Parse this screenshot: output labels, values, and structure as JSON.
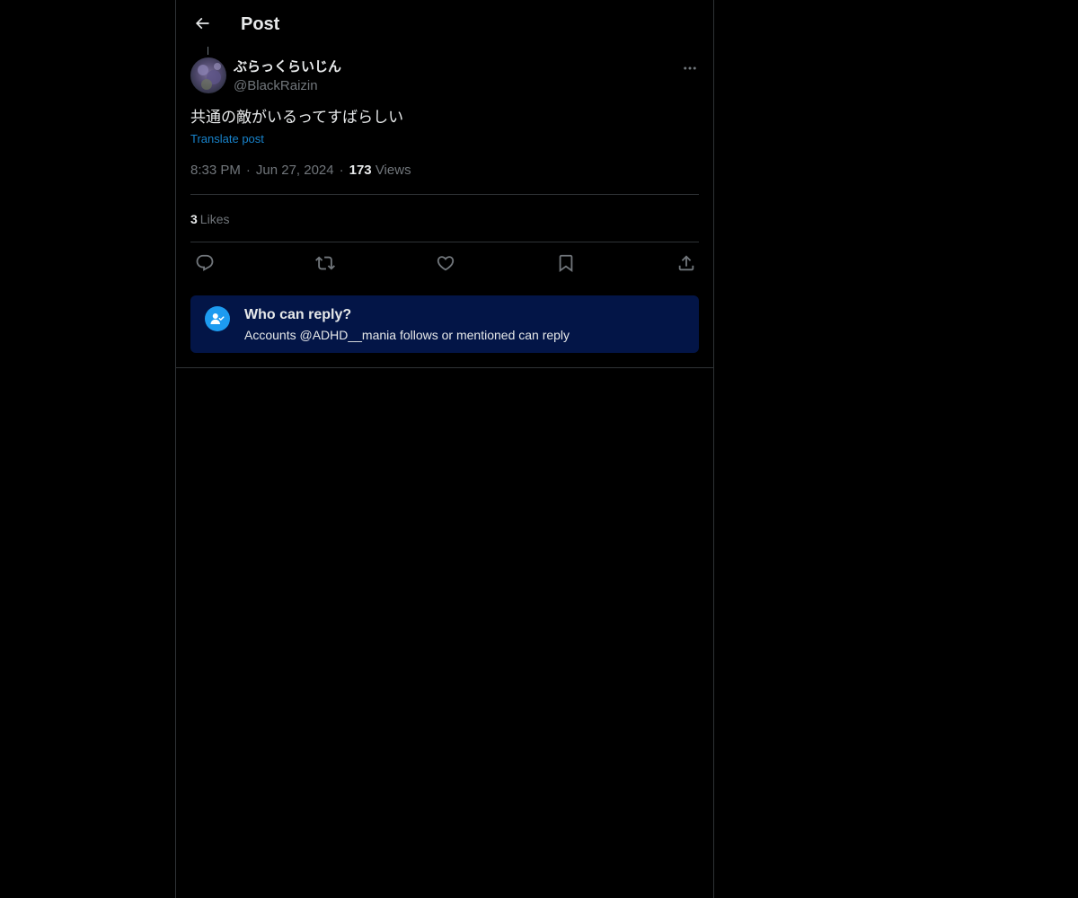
{
  "header": {
    "title": "Post",
    "back_icon": "arrow-left-icon"
  },
  "post": {
    "author": {
      "name": "ぶらっくらいじん",
      "handle": "@BlackRaizin"
    },
    "text": "共通の敵がいるってすばらしい",
    "translate_label": "Translate post",
    "time": "8:33 PM",
    "date": "Jun 27, 2024",
    "views_count": "173",
    "views_label": "Views",
    "likes_count": "3",
    "likes_label": "Likes"
  },
  "actions": [
    {
      "name": "reply",
      "icon": "reply-icon"
    },
    {
      "name": "repost",
      "icon": "repost-icon"
    },
    {
      "name": "like",
      "icon": "heart-icon"
    },
    {
      "name": "bookmark",
      "icon": "bookmark-icon"
    },
    {
      "name": "share",
      "icon": "share-icon"
    }
  ],
  "reply_restriction": {
    "title": "Who can reply?",
    "description": "Accounts @ADHD__mania follows or mentioned can reply"
  },
  "colors": {
    "background": "#000000",
    "text": "#e7e9ea",
    "muted": "#71767b",
    "accent": "#1d9bf0",
    "divider": "#2f3336",
    "reply_box_bg": "#031547"
  }
}
